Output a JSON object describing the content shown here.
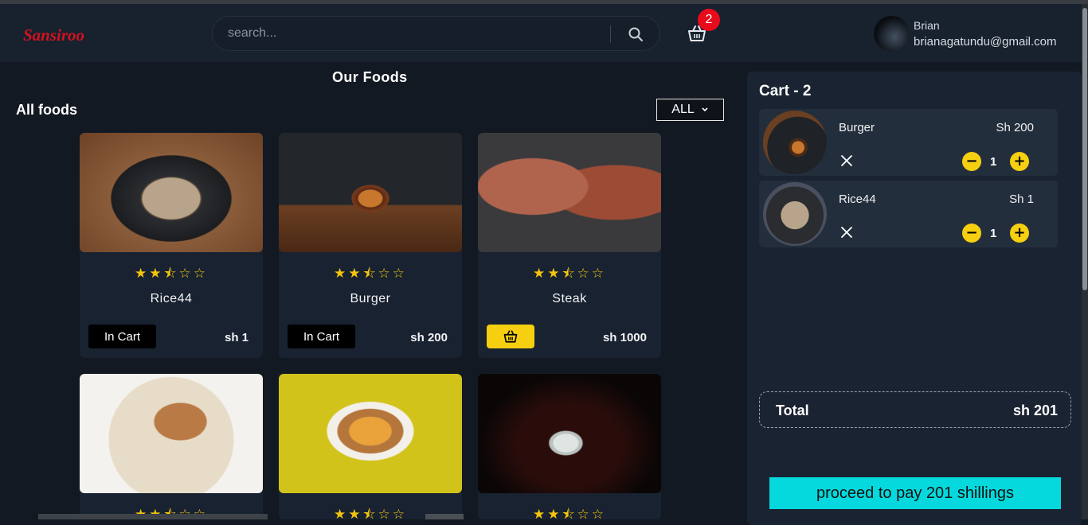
{
  "header": {
    "logo": "Sansiroo",
    "search_placeholder": "search...",
    "cart_count": "2",
    "user_name": "Brian",
    "user_email": "brianagatundu@gmail.com"
  },
  "main": {
    "section_title": "Our Foods",
    "subtitle": "All foods",
    "filter_label": "ALL",
    "foods": [
      {
        "name": "Rice44",
        "price": "sh 1",
        "rating": 2.5,
        "in_cart": true,
        "button_label": "In Cart"
      },
      {
        "name": "Burger",
        "price": "sh 200",
        "rating": 2.5,
        "in_cart": true,
        "button_label": "In Cart"
      },
      {
        "name": "Steak",
        "price": "sh 1000",
        "rating": 2.5,
        "in_cart": false,
        "button_label": ""
      },
      {
        "name": "",
        "price": "",
        "rating": 2.5,
        "in_cart": false,
        "button_label": ""
      },
      {
        "name": "",
        "price": "",
        "rating": 2.5,
        "in_cart": false,
        "button_label": ""
      },
      {
        "name": "",
        "price": "",
        "rating": 2.5,
        "in_cart": false,
        "button_label": ""
      }
    ],
    "stars": "★★⯪☆☆"
  },
  "cart": {
    "title": "Cart - 2",
    "items": [
      {
        "name": "Burger",
        "price": "Sh 200",
        "qty": "1"
      },
      {
        "name": "Rice44",
        "price": "Sh 1",
        "qty": "1"
      }
    ],
    "total_label": "Total",
    "total_value": "sh 201",
    "pay_label": "proceed to pay 201 shillings"
  },
  "colors": {
    "accent": "#f6cf10",
    "badge": "#e80b1c",
    "logo": "#d3121f",
    "pay_button": "#05d9dd"
  }
}
